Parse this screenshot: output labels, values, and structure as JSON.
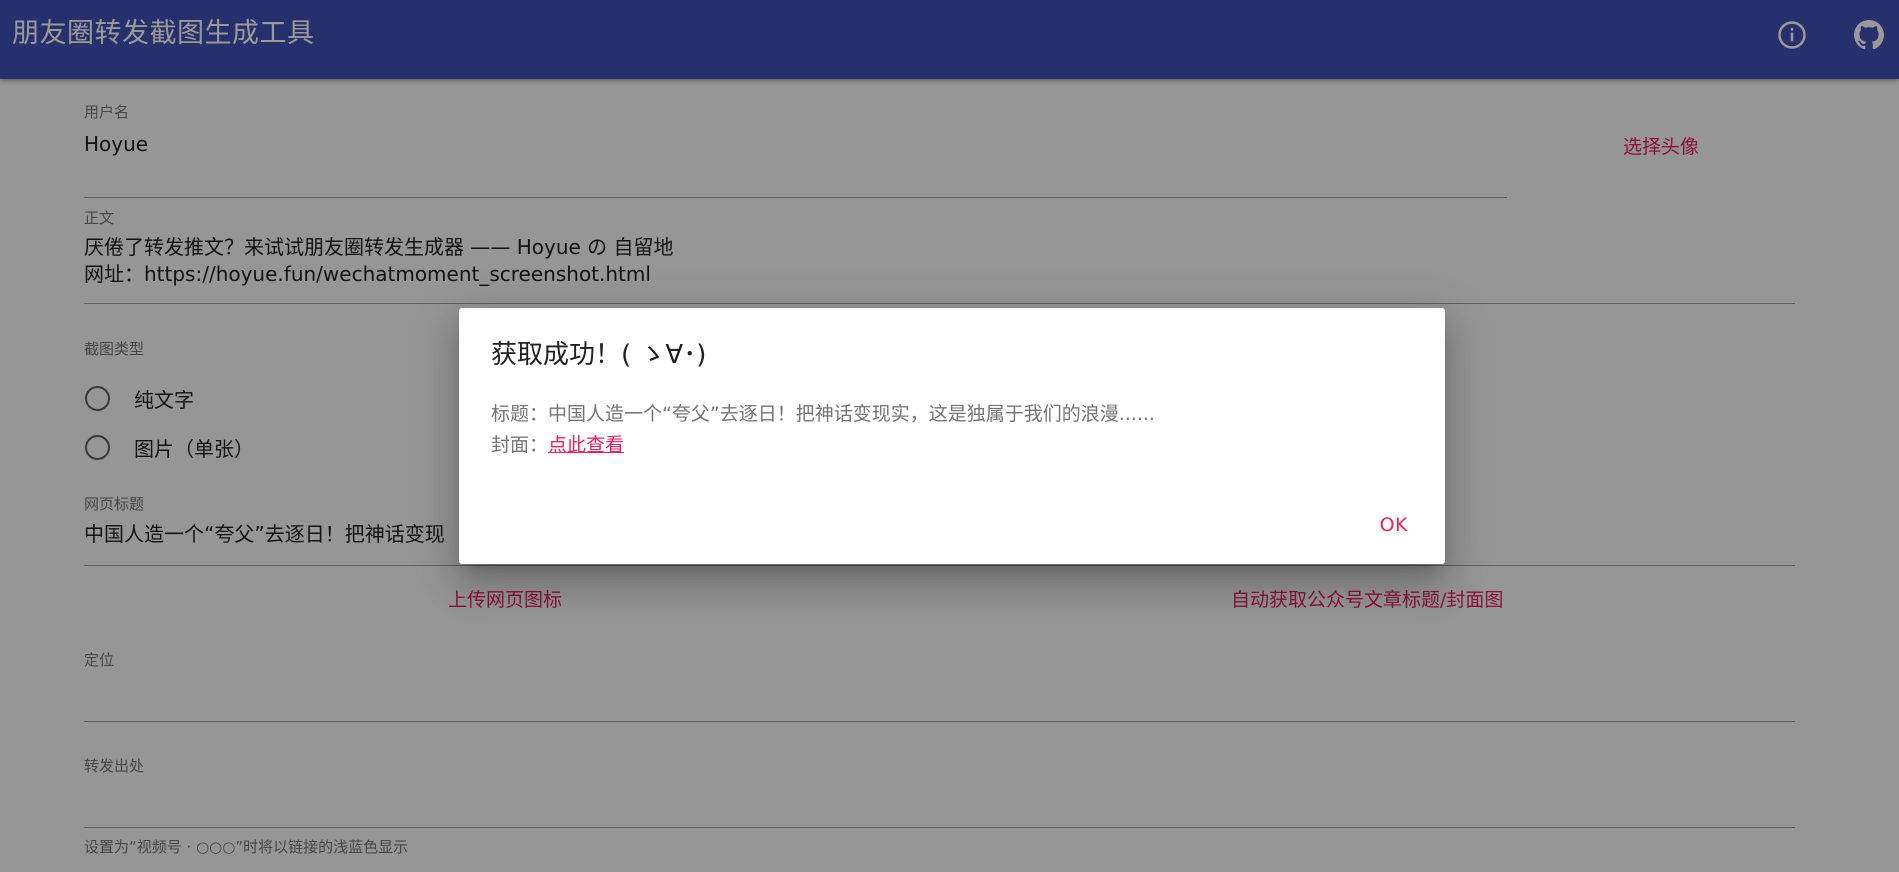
{
  "header": {
    "title": "朋友圈转发截图生成工具",
    "info_icon": "info-icon",
    "github_icon": "github-icon",
    "color": "#3f51b5"
  },
  "form": {
    "username": {
      "label": "用户名",
      "value": "Hoyue"
    },
    "choose_avatar_label": "选择头像",
    "body": {
      "label": "正文",
      "line1": "厌倦了转发推文？来试试朋友圈转发生成器 —— Hoyue の 自留地",
      "line2": "网址：https://hoyue.fun/wechatmoment_screenshot.html"
    },
    "screenshot_type": {
      "label": "截图类型",
      "options": [
        "纯文字",
        "图片（单张）"
      ]
    },
    "page_title": {
      "label": "网页标题",
      "value": "中国人造一个“夸父”去逐日！把神话变现"
    },
    "upload_icon_label": "上传网页图标",
    "auto_fetch_label": "自动获取公众号文章标题/封面图",
    "location": {
      "label": "定位",
      "value": ""
    },
    "forward_source": {
      "label": "转发出处",
      "value": "",
      "helper": "设置为“视频号 · ○○○”时将以链接的浅蓝色显示"
    },
    "accent_color": "#e91e63"
  },
  "dialog": {
    "title": "获取成功！( ゝ∀･)",
    "title_label": "标题：",
    "title_value": "中国人造一个“夸父”去逐日！把神话变现实，这是独属于我们的浪漫......",
    "cover_label": "封面：",
    "cover_link": "点此查看",
    "ok_label": "OK"
  }
}
